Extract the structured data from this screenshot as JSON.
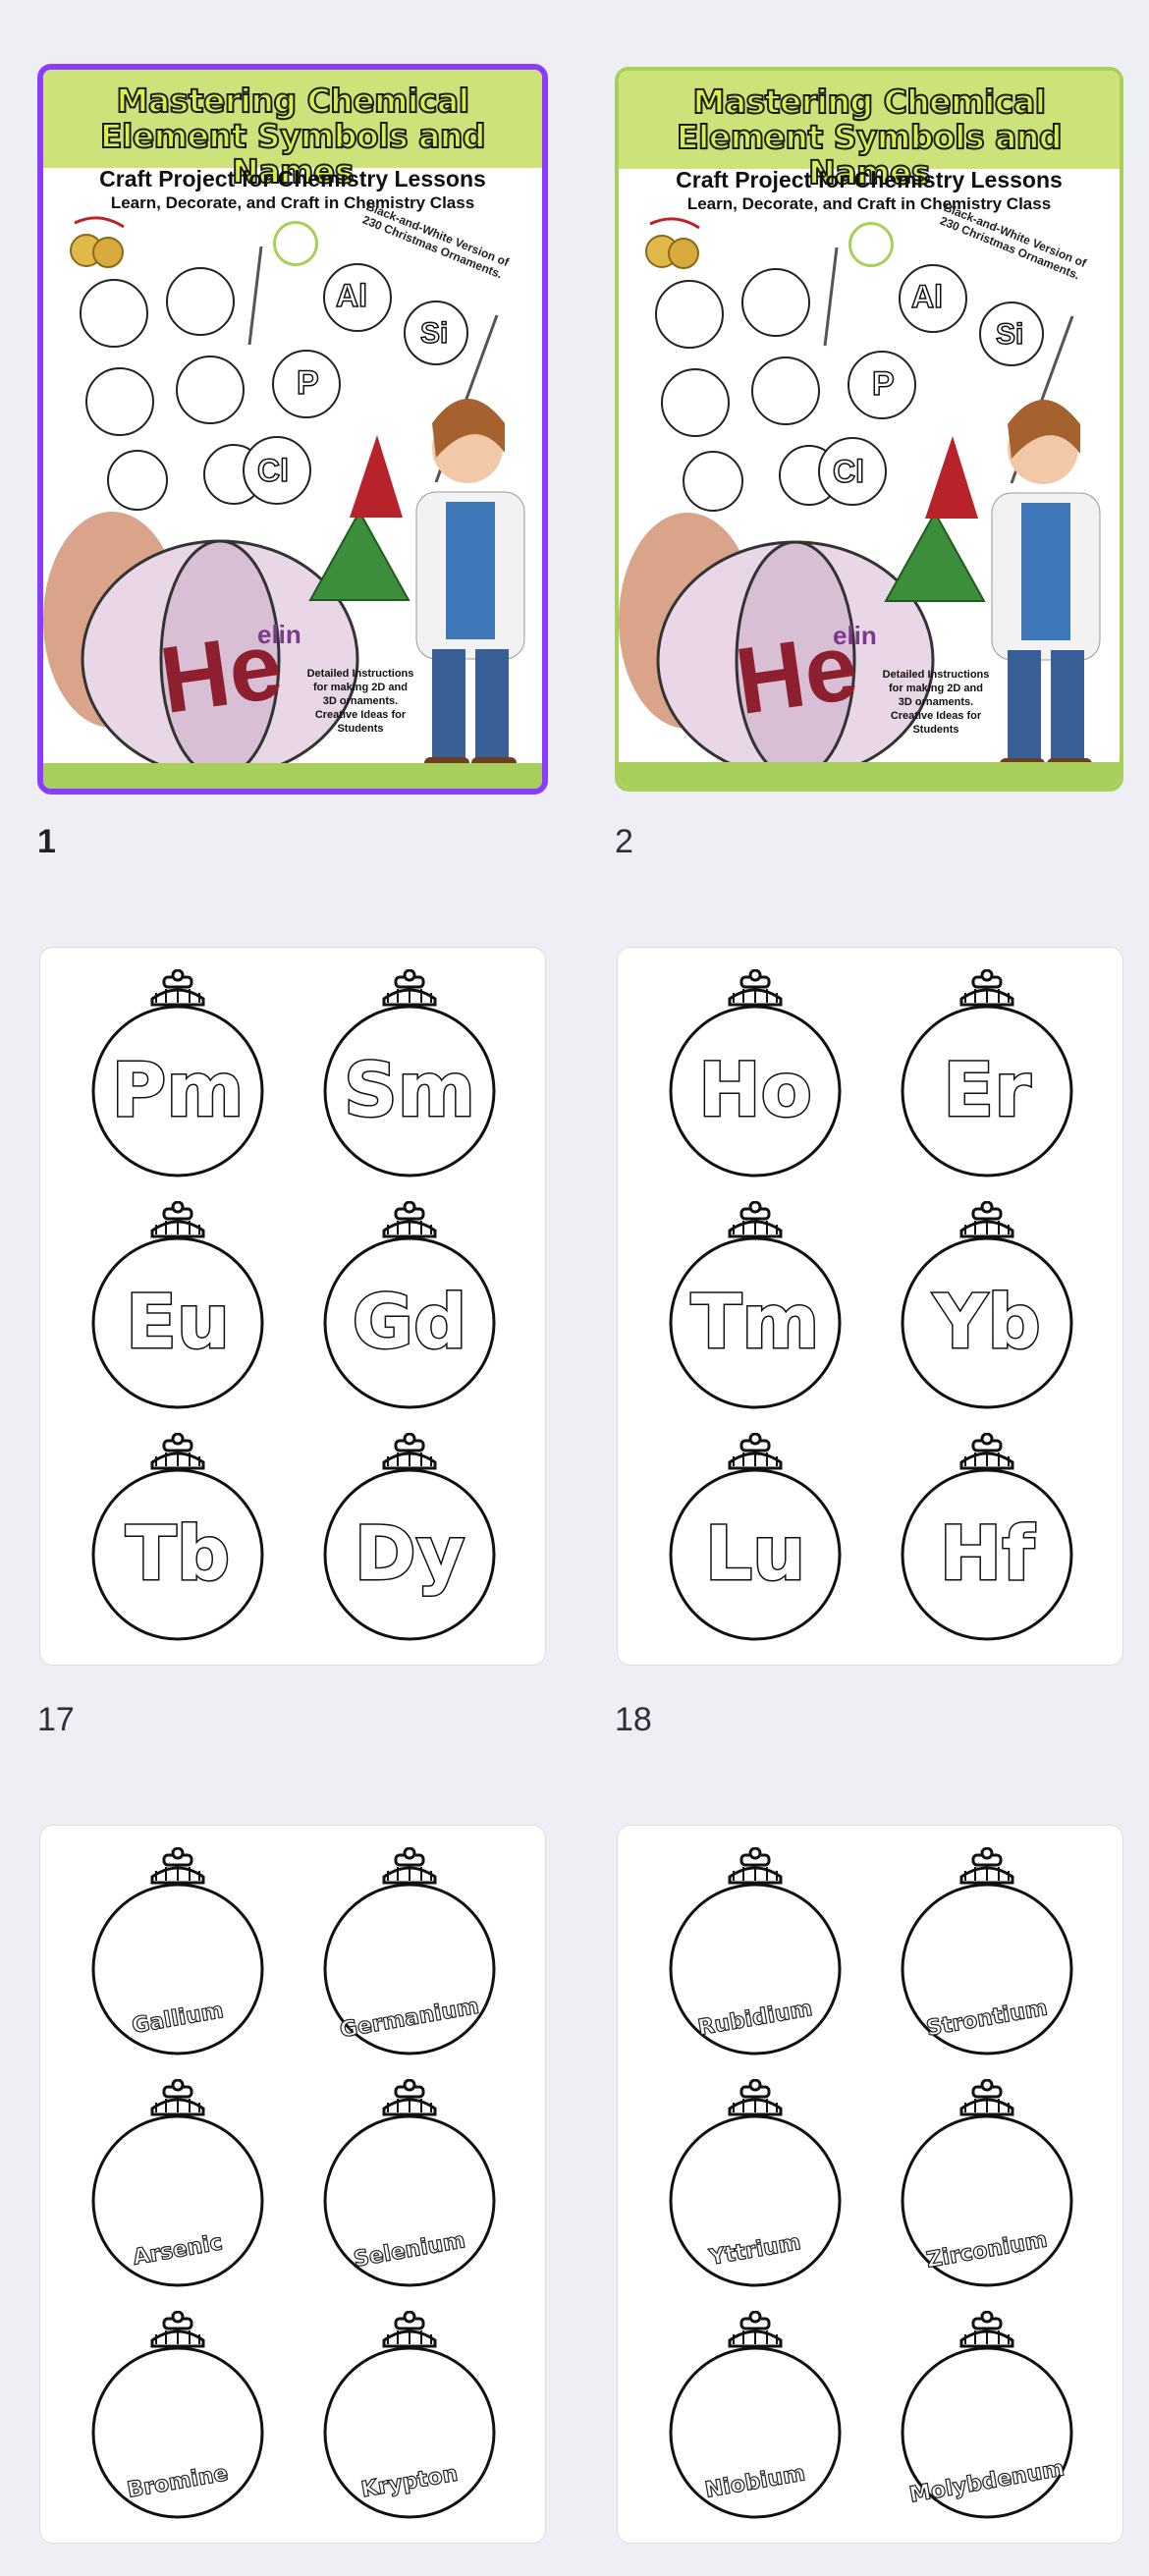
{
  "pages": [
    {
      "number": "1",
      "selected": true,
      "cover": {
        "title_line1": "Mastering Chemical",
        "title_line2": "Element Symbols and Names",
        "subtitle": "Craft Project for Chemistry Lessons",
        "tagline": "Learn, Decorate, and Craft in Chemistry Class",
        "note": "Black-and-White Version of 230 Christmas Ornaments.",
        "details": "Detailed Instructions for making 2D and 3D ornaments. Creative Ideas for Students",
        "small_symbols": [
          "Al",
          "Si",
          "P",
          "Cl"
        ],
        "big_symbol": "He",
        "partial_name": "elin"
      }
    },
    {
      "number": "2",
      "selected": false,
      "cover": {
        "title_line1": "Mastering Chemical",
        "title_line2": "Element Symbols and Names",
        "subtitle": "Craft Project for Chemistry Lessons",
        "tagline": "Learn, Decorate, and Craft in Chemistry Class",
        "note": "Black-and-White Version of 230 Christmas Ornaments.",
        "details": "Detailed Instructions for making 2D and 3D ornaments. Creative Ideas for Students",
        "small_symbols": [
          "Al",
          "Si",
          "P",
          "Cl"
        ],
        "big_symbol": "He",
        "partial_name": "elin"
      }
    },
    {
      "number": "17",
      "symbols": [
        "Pm",
        "Sm",
        "Eu",
        "Gd",
        "Tb",
        "Dy"
      ]
    },
    {
      "number": "18",
      "symbols": [
        "Ho",
        "Er",
        "Tm",
        "Yb",
        "Lu",
        "Hf"
      ]
    },
    {
      "number": "",
      "names": [
        "Gallium",
        "Germanium",
        "Arsenic",
        "Selenium",
        "Bromine",
        "Krypton"
      ]
    },
    {
      "number": "",
      "names": [
        "Rubidium",
        "Strontium",
        "Yttrium",
        "Zirconium",
        "Niobium",
        "Molybdenum"
      ]
    }
  ],
  "colors": {
    "selected_border": "#8b3dff",
    "cover_accent": "#a8cf5b",
    "background": "#eeeff5"
  }
}
